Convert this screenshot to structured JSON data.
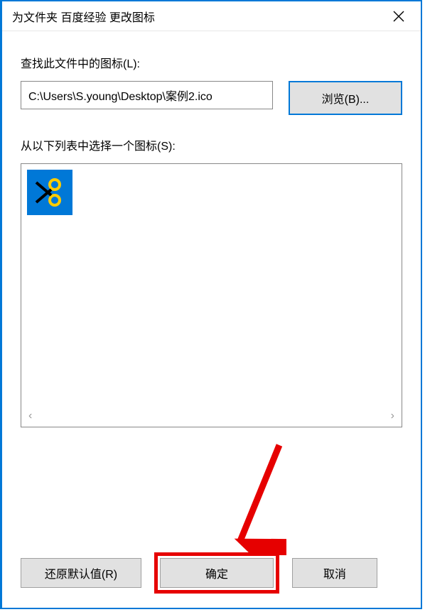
{
  "titlebar": {
    "title": "为文件夹 百度经验 更改图标"
  },
  "labels": {
    "lookup": "查找此文件中的图标(L):",
    "select": "从以下列表中选择一个图标(S):"
  },
  "path": {
    "value": "C:\\Users\\S.young\\Desktop\\案例2.ico"
  },
  "buttons": {
    "browse": "浏览(B)...",
    "restore": "还原默认值(R)",
    "ok": "确定",
    "cancel": "取消"
  },
  "icons": {
    "selected": "scissors-icon"
  },
  "colors": {
    "accent": "#0078d7",
    "highlight": "#e60000"
  }
}
